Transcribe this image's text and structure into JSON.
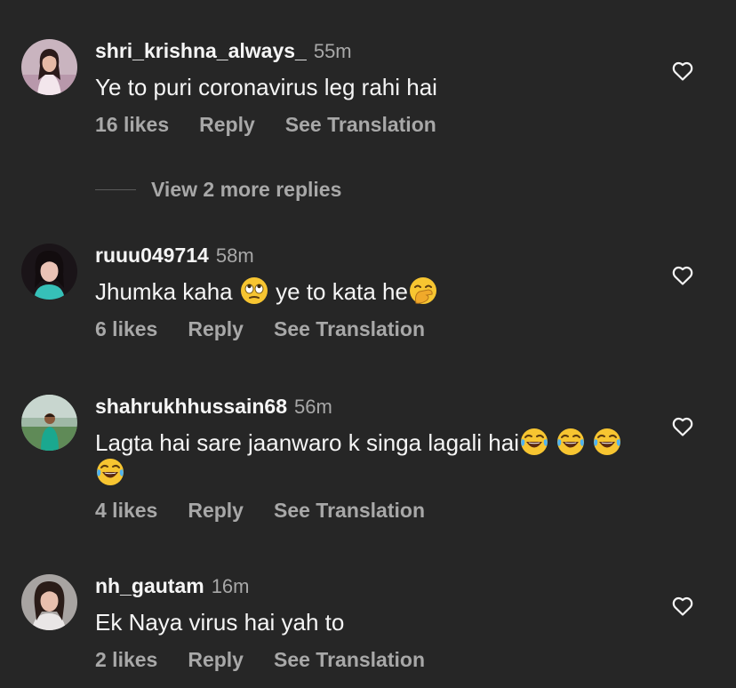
{
  "comments": [
    {
      "username": "shri_krishna_always_",
      "time": "55m",
      "text_parts": [
        "Ye to puri coronavirus  leg rahi hai"
      ],
      "likes": "16 likes",
      "reply": "Reply",
      "translate": "See Translation"
    },
    {
      "username": "ruuu049714",
      "time": "58m",
      "text_parts": [
        "Jhumka kaha ",
        " ye to kata he"
      ],
      "emojis": [
        "face-with-rolling-eyes-emoji",
        "face-with-hand-over-mouth-emoji"
      ],
      "likes": "6 likes",
      "reply": "Reply",
      "translate": "See Translation"
    },
    {
      "username": "shahrukhhussain68",
      "time": "56m",
      "text_parts": [
        "Lagta hai sare jaanwaro k singa lagali hai"
      ],
      "emojis": [
        "face-with-tears-of-joy-emoji",
        "face-with-tears-of-joy-emoji",
        "face-with-tears-of-joy-emoji",
        "face-with-tears-of-joy-emoji"
      ],
      "likes": "4 likes",
      "reply": "Reply",
      "translate": "See Translation"
    },
    {
      "username": "nh_gautam",
      "time": "16m",
      "text_parts": [
        "Ek Naya virus hai yah to"
      ],
      "likes": "2 likes",
      "reply": "Reply",
      "translate": "See Translation"
    }
  ],
  "view_replies": "View 2 more replies",
  "icons": {
    "like": "heart-outline-icon"
  },
  "colors": {
    "background": "#262626",
    "primary_text": "#f5f5f5",
    "secondary_text": "#a8a8a8"
  }
}
